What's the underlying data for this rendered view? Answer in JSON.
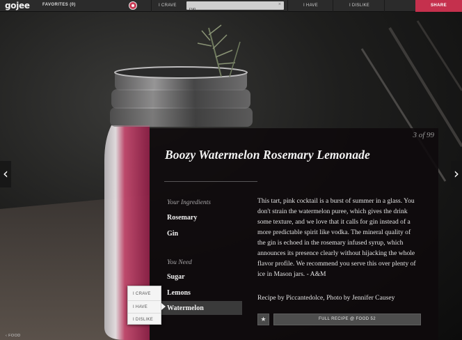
{
  "topbar": {
    "logo": "gojee",
    "favorites": "FAVORITES (0)",
    "crave_label": "I CRAVE",
    "search_value": "Gin",
    "search_clear": "×",
    "have_label": "I HAVE",
    "dislike_label": "I DISLIKE",
    "share_label": "SHARE"
  },
  "nav": {
    "prev_arrow": "‹",
    "next_arrow": "›",
    "back_label": "‹ FOOD"
  },
  "recipe": {
    "counter": "3 of 99",
    "title": "Boozy Watermelon Rosemary Lemonade",
    "your_ingredients_label": "Your Ingredients",
    "your_ingredients": [
      "Rosemary",
      "Gin"
    ],
    "you_need_label": "You Need",
    "you_need": [
      "Sugar",
      "Lemons",
      "Watermelon"
    ],
    "description": "This tart, pink cocktail is a burst of summer in a glass. You don't strain the watermelon puree, which gives the drink some texture, and we love that it calls for gin instead of a more predictable spirit like vodka. The mineral quality of the gin is echoed in the rosemary infused syrup, which announces its presence clearly without hijacking the whole flavor profile. We recommend you serve this over plenty of ice in Mason jars. - A&M",
    "credit": "Recipe by Piccantedolce, Photo by Jennifer Causey",
    "star_icon": "★",
    "full_recipe_label": "FULL RECIPE @ FOOD 52"
  },
  "popover": {
    "items": [
      "I CRAVE",
      "I HAVE",
      "I DISLIKE"
    ]
  },
  "colors": {
    "accent": "#c5304d",
    "topbar": "#2b2b2b",
    "card": "#0e0a0c"
  }
}
